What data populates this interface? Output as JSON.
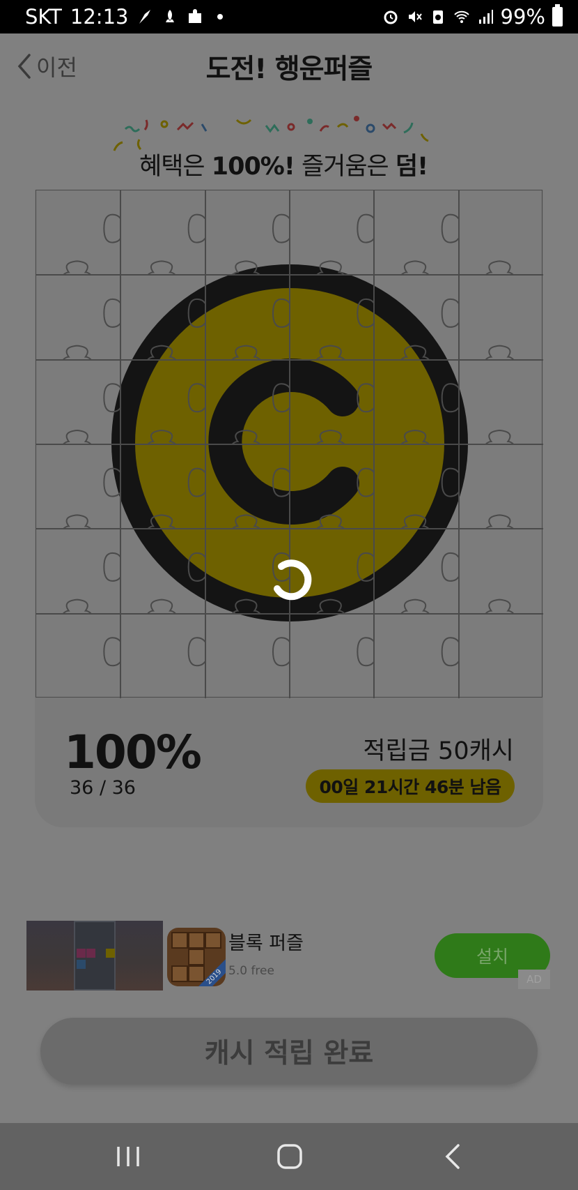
{
  "status_bar": {
    "carrier": "SKT",
    "time": "12:13",
    "battery": "99%",
    "left_icons": [
      "quill-icon",
      "rocket-icon",
      "puzzle-icon",
      "dot-icon"
    ],
    "right_icons": [
      "alarm-icon",
      "mute-icon",
      "recycle-icon",
      "wifi-icon",
      "signal-icon",
      "battery-icon"
    ]
  },
  "header": {
    "back_label": "이전",
    "title": "도전! 행운퍼즐"
  },
  "banner": {
    "part1": "혜택은 ",
    "part2": "100%!",
    "part3": " 즐거움은 ",
    "part4": "덤!"
  },
  "puzzle": {
    "grid_rows": 6,
    "grid_cols": 6,
    "logo_icon": "cash-coin-icon",
    "pieces_completed": 36,
    "pieces_total": 36
  },
  "progress": {
    "percent": "100%",
    "count": "36 / 36",
    "reward": "적립금 50캐시",
    "time_left": "00일 21시간 46분 남음"
  },
  "ad": {
    "name": "블록 퍼즐",
    "rating": "5.0 free",
    "install_label": "설치",
    "badge": "AD",
    "icon_ribbon": "2019"
  },
  "complete_button": "캐시 적립 완료",
  "colors": {
    "overlay": "#808080",
    "coin_yellow": "#6e6100",
    "coin_ring": "#141414",
    "install_green": "#2f7a19"
  },
  "nav_bar": {
    "items": [
      "recent-apps-icon",
      "home-icon",
      "back-icon"
    ]
  }
}
